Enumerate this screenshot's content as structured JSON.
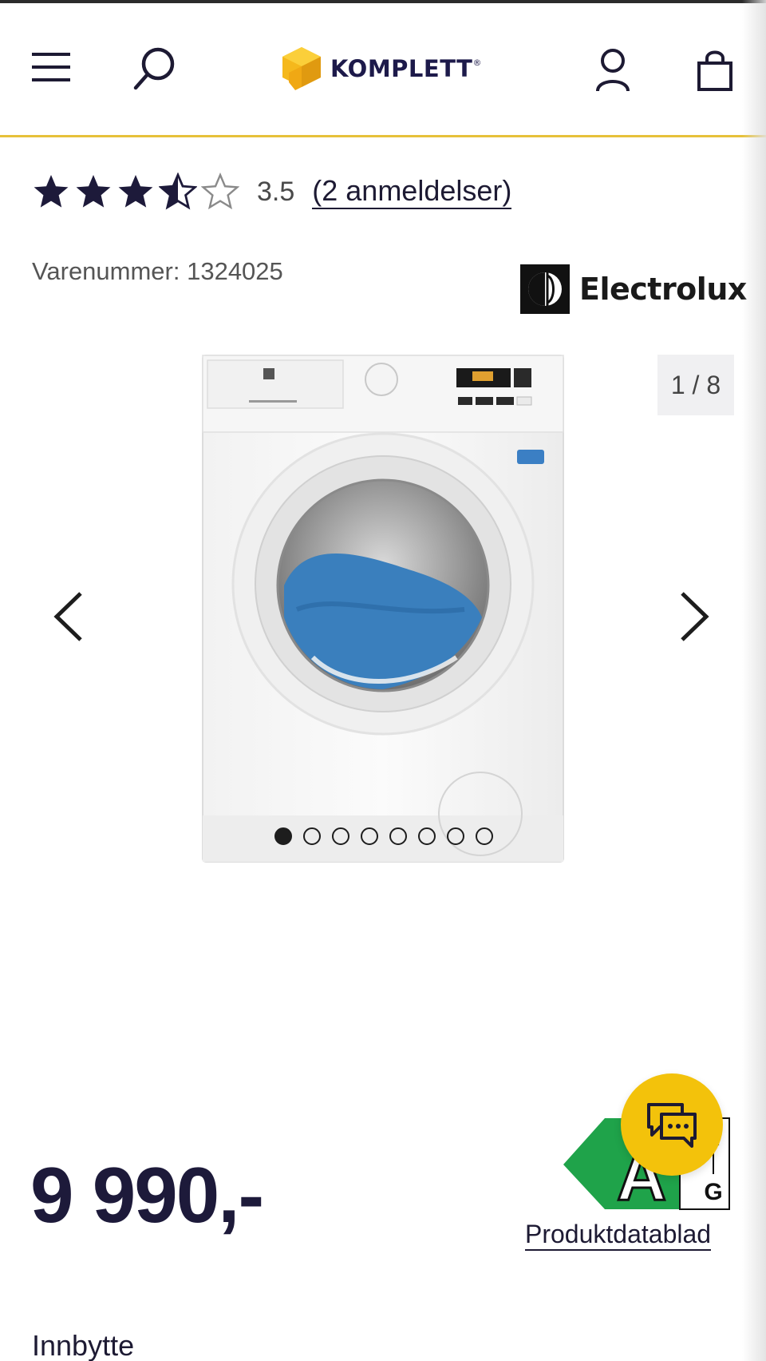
{
  "header": {
    "logo_text": "KOMPLETT",
    "logo_mark": "®",
    "accent_color": "#e6c13a",
    "brand_navy": "#1d1a4a",
    "icons": [
      "menu-icon",
      "search-icon",
      "account-icon",
      "cart-icon"
    ]
  },
  "product": {
    "rating": {
      "stars_filled": 3.5,
      "stars_total": 5,
      "value_text": "3.5",
      "reviews_text": "(2 anmeldelser)"
    },
    "sku_text": "Varenummer: 1324025",
    "brand_name": "Electrolux",
    "gallery": {
      "counter_text": "1 / 8",
      "current": 1,
      "total": 8
    },
    "price_text": "9 990,-",
    "energy_label": {
      "class": "A",
      "scale_top": "A",
      "scale_bottom": "G",
      "color": "#1fa34a"
    },
    "datasheet_link": "Produktdatablad"
  },
  "section_heading": "Innbytte",
  "chat": {
    "icon": "chat-icon",
    "color": "#f3c20b"
  }
}
